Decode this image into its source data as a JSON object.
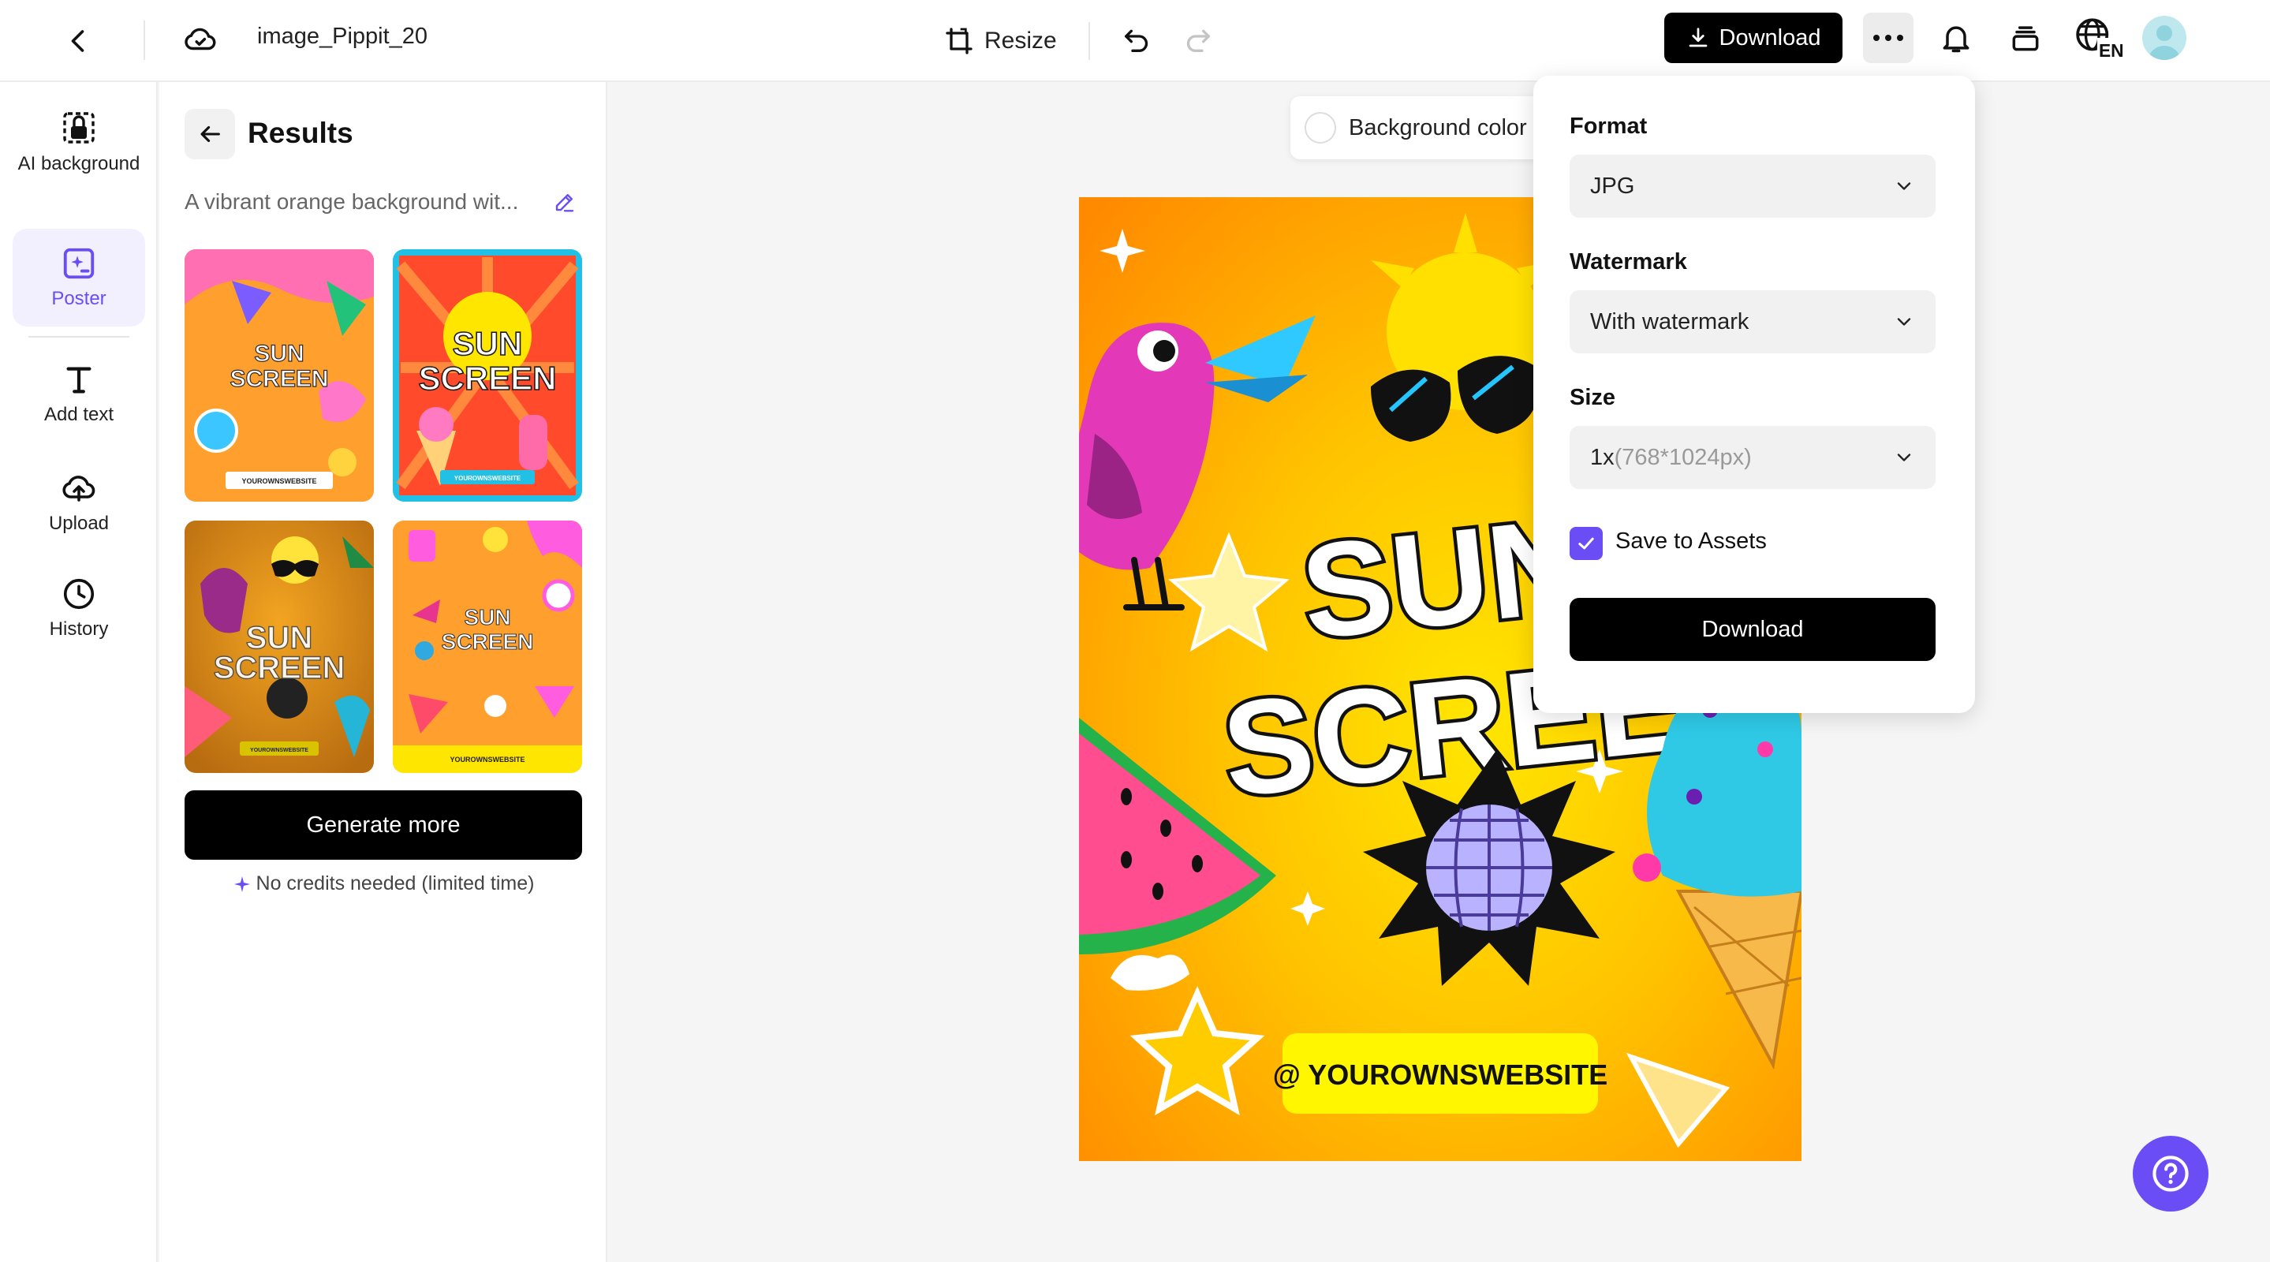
{
  "topbar": {
    "filename": "image_Pippit_20",
    "resize_label": "Resize",
    "download_label": "Download",
    "language": "EN"
  },
  "rail": {
    "items": [
      {
        "label": "AI background",
        "icon": "ai-background-icon"
      },
      {
        "label": "Poster",
        "icon": "poster-icon",
        "active": true
      },
      {
        "label": "Add text",
        "icon": "text-icon"
      },
      {
        "label": "Upload",
        "icon": "upload-icon"
      },
      {
        "label": "History",
        "icon": "history-icon"
      }
    ]
  },
  "results": {
    "title": "Results",
    "prompt": "A vibrant orange background wit...",
    "thumbnails": [
      {
        "title_line1": "SUN",
        "title_line2": "SCREEN",
        "footer": "YOUROWNSWEBSITE"
      },
      {
        "title_line1": "SUN",
        "title_line2": "SCREEN",
        "footer": "YOUROWNSWEBSITE"
      },
      {
        "title_line1": "SUN",
        "title_line2": "SCREEN",
        "footer": "YOUROWNSWEBSITE"
      },
      {
        "title_line1": "SUN",
        "title_line2": "SCREEN",
        "footer": "YOUROWNSWEBSITE"
      }
    ],
    "generate_label": "Generate more",
    "credits_note": "No credits needed (limited time)"
  },
  "canvas": {
    "bg_color_label": "Background color",
    "poster": {
      "title_line1": "SUN",
      "title_line2": "SCREE",
      "website": "@ YOUROWNSWEBSITE"
    }
  },
  "download_panel": {
    "format_label": "Format",
    "format_value": "JPG",
    "watermark_label": "Watermark",
    "watermark_value": "With watermark",
    "size_label": "Size",
    "size_value_main": "1x",
    "size_value_detail": "(768*1024px)",
    "save_assets_label": "Save to Assets",
    "save_assets_checked": true,
    "download_label": "Download"
  },
  "colors": {
    "accent": "#6a4df5",
    "primary_button": "#000000",
    "poster_orange": "#ff9a0a",
    "poster_yellow": "#ffe600"
  }
}
